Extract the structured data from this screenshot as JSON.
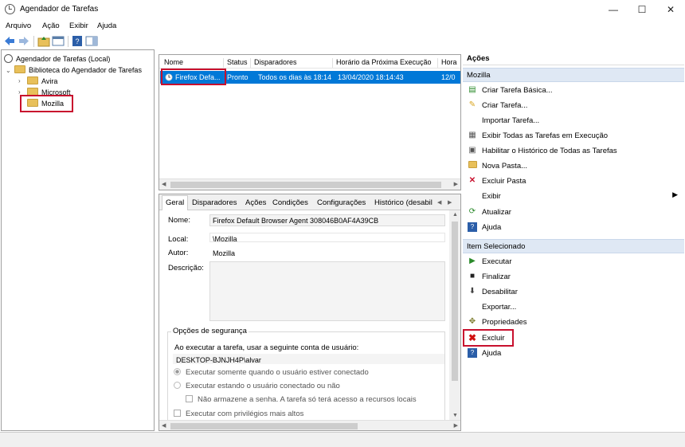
{
  "window": {
    "title": "Agendador de Tarefas",
    "minimize": "—",
    "maximize": "☐",
    "close": "✕"
  },
  "menu": [
    "Arquivo",
    "Ação",
    "Exibir",
    "Ajuda"
  ],
  "tree": {
    "root": "Agendador de Tarefas (Local)",
    "library": "Biblioteca do Agendador de Tarefas",
    "children": [
      "Avira",
      "Microsoft",
      "Mozilla"
    ]
  },
  "task_list": {
    "columns": [
      "Nome",
      "Status",
      "Disparadores",
      "Horário da Próxima Execução",
      "Hora"
    ],
    "rows": [
      {
        "name": "Firefox Defa...",
        "status": "Pronto",
        "triggers": "Todos os dias às 18:14",
        "next_run": "13/04/2020 18:14:43",
        "last": "12/0"
      }
    ]
  },
  "detail": {
    "tabs": [
      "Geral",
      "Disparadores",
      "Ações",
      "Condições",
      "Configurações",
      "Histórico (desabil"
    ],
    "name_label": "Nome:",
    "name_value": "Firefox Default Browser Agent 308046B0AF4A39CB",
    "location_label": "Local:",
    "location_value": "\\Mozilla",
    "author_label": "Autor:",
    "author_value": "Mozilla",
    "description_label": "Descrição:",
    "security": {
      "title": "Opções de segurança",
      "run_as_text": "Ao executar a tarefa, usar a seguinte conta de usuário:",
      "account": "DESKTOP-BJNJH4P\\alvar",
      "option_logged_on": "Executar somente quando o usuário estiver conectado",
      "option_logged_any": "Executar estando o usuário conectado ou não",
      "option_no_password": "Não armazene a senha. A tarefa só terá acesso a recursos locais",
      "option_highest": "Executar com privilégios mais altos"
    }
  },
  "actions": {
    "title": "Ações",
    "section_folder": "Mozilla",
    "folder_items": [
      {
        "label": "Criar Tarefa Básica...",
        "icon": "create-basic-task-icon"
      },
      {
        "label": "Criar Tarefa...",
        "icon": "create-task-icon"
      },
      {
        "label": "Importar Tarefa...",
        "icon": ""
      },
      {
        "label": "Exibir Todas as Tarefas em Execução",
        "icon": "running-tasks-icon"
      },
      {
        "label": "Habilitar o Histórico de Todas as Tarefas",
        "icon": "history-icon"
      },
      {
        "label": "Nova Pasta...",
        "icon": "new-folder-icon"
      },
      {
        "label": "Excluir Pasta",
        "icon": "delete-folder-icon"
      },
      {
        "label": "Exibir",
        "icon": ""
      },
      {
        "label": "Atualizar",
        "icon": "refresh-icon"
      },
      {
        "label": "Ajuda",
        "icon": "help-icon"
      }
    ],
    "section_item": "Item Selecionado",
    "item_items": [
      {
        "label": "Executar",
        "icon": "run-icon"
      },
      {
        "label": "Finalizar",
        "icon": "stop-icon"
      },
      {
        "label": "Desabilitar",
        "icon": "disable-icon"
      },
      {
        "label": "Exportar...",
        "icon": ""
      },
      {
        "label": "Propriedades",
        "icon": "properties-icon"
      },
      {
        "label": "Excluir",
        "icon": "delete-icon"
      },
      {
        "label": "Ajuda",
        "icon": "help-icon"
      }
    ]
  },
  "colors": {
    "selection": "#0078d7",
    "highlight_box": "#c8102e",
    "section_band": "#dfe8f4"
  }
}
